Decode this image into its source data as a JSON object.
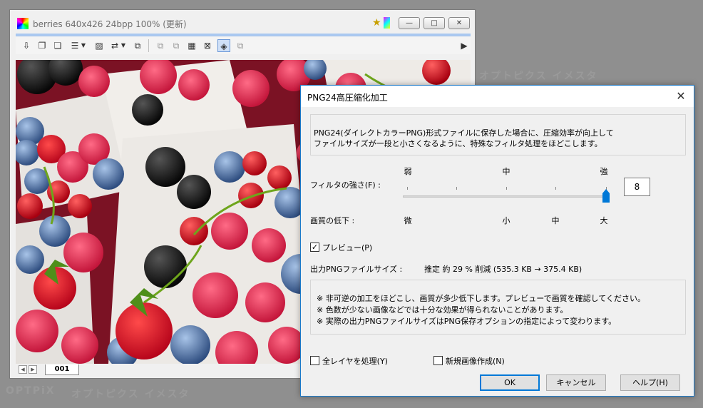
{
  "watermark": {
    "opt_text": "OPTPiX",
    "kana_text": "オプトピクス イメスタ"
  },
  "image_window": {
    "title": "berries  640x426  24bpp  100%  (更新)",
    "minimize_symbol": "▭",
    "maximize_symbol": "▭",
    "close_symbol": "✕",
    "toolbar_overflow": "▶",
    "status": {
      "prev_label": "◀",
      "next_label": "▶",
      "tab_label": "001"
    }
  },
  "dialog": {
    "title": "PNG24高圧縮化加工",
    "close_symbol": "✕",
    "description": [
      "PNG24(ダイレクトカラーPNG)形式ファイルに保存した場合に、圧縮効率が向上して",
      "ファイルサイズが一段と小さくなるように、特殊なフィルタ処理をほどこします。"
    ],
    "filter_label": "フィルタの強さ(F) :",
    "strength_ticks": [
      "弱",
      "中",
      "強"
    ],
    "filter_value": "8",
    "filter_level": 8,
    "filter_max": 8,
    "quality_label": "画質の低下 :",
    "quality_ticks": [
      "微",
      "小",
      "中",
      "大"
    ],
    "preview_label": "プレビュー(P)",
    "preview_checked": true,
    "output_label": "出力PNGファイルサイズ :",
    "output_value": "推定 約 29 % 削減 (535.3 KB → 375.4 KB)",
    "notes": [
      "※ 非可逆の加工をほどこし、画質が多少低下します。プレビューで画質を確認してください。",
      "※ 色数が少ない画像などでは十分な効果が得られないことがあります。",
      "※ 実際の出力PNGファイルサイズはPNG保存オプションの指定によって変わります。"
    ],
    "all_layers_label": "全レイヤを処理(Y)",
    "all_layers_checked": false,
    "new_image_label": "新規画像作成(N)",
    "new_image_checked": false,
    "ok_label": "OK",
    "cancel_label": "キャンセル",
    "help_label": "ヘルプ(H)"
  },
  "colors": {
    "accent": "#0078d7",
    "dialog_border": "#1979ca",
    "desktop": "#8f8f8f"
  }
}
